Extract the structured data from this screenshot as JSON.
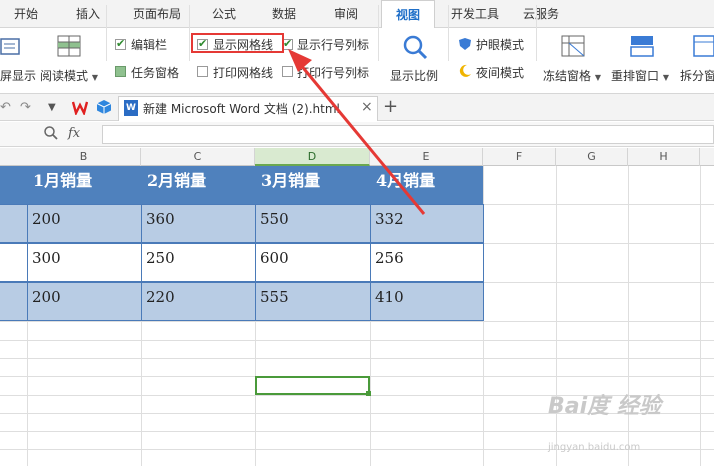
{
  "menu": {
    "tabs": [
      "开始",
      "插入",
      "页面布局",
      "公式",
      "数据",
      "审阅",
      "视图",
      "开发工具",
      "云服务"
    ],
    "active": "视图"
  },
  "ribbon": {
    "fullscreen_label": "屏显示",
    "reading_mode_label": "阅读模式",
    "edit_bar_label": "编辑栏",
    "task_pane_label": "任务窗格",
    "show_gridlines_label": "显示网格线",
    "print_gridlines_label": "打印网格线",
    "show_rowcol_label": "显示行号列标",
    "print_rowcol_label": "打印行号列标",
    "zoom_label": "显示比例",
    "eye_mode_label": "护眼模式",
    "night_mode_label": "夜间模式",
    "freeze_label": "冻结窗格",
    "arrange_label": "重排窗口",
    "split_label": "拆分窗",
    "edit_bar_checked": true,
    "task_pane_checked": true,
    "show_gridlines_checked": true,
    "print_gridlines_checked": false,
    "show_rowcol_checked": true,
    "print_rowcol_checked": false
  },
  "doctab": {
    "title": "新建 Microsoft Word 文档 (2).html",
    "close": "×",
    "add": "+"
  },
  "formula": {
    "fx": "fx"
  },
  "columns": [
    "B",
    "C",
    "D",
    "E",
    "F",
    "G",
    "H"
  ],
  "table": {
    "headers": [
      "1月销量",
      "2月销量",
      "3月销量",
      "4月销量"
    ],
    "rows": [
      [
        "200",
        "360",
        "550",
        "332"
      ],
      [
        "300",
        "250",
        "600",
        "256"
      ],
      [
        "200",
        "220",
        "555",
        "410"
      ]
    ]
  },
  "watermark": {
    "logo": "Bai度 经验",
    "url": "jingyan.baidu.com"
  },
  "colors": {
    "header_blue": "#4f81bd",
    "band_blue": "#b8cce4",
    "highlight_red": "#e53935",
    "select_green": "#4a9a3a"
  }
}
